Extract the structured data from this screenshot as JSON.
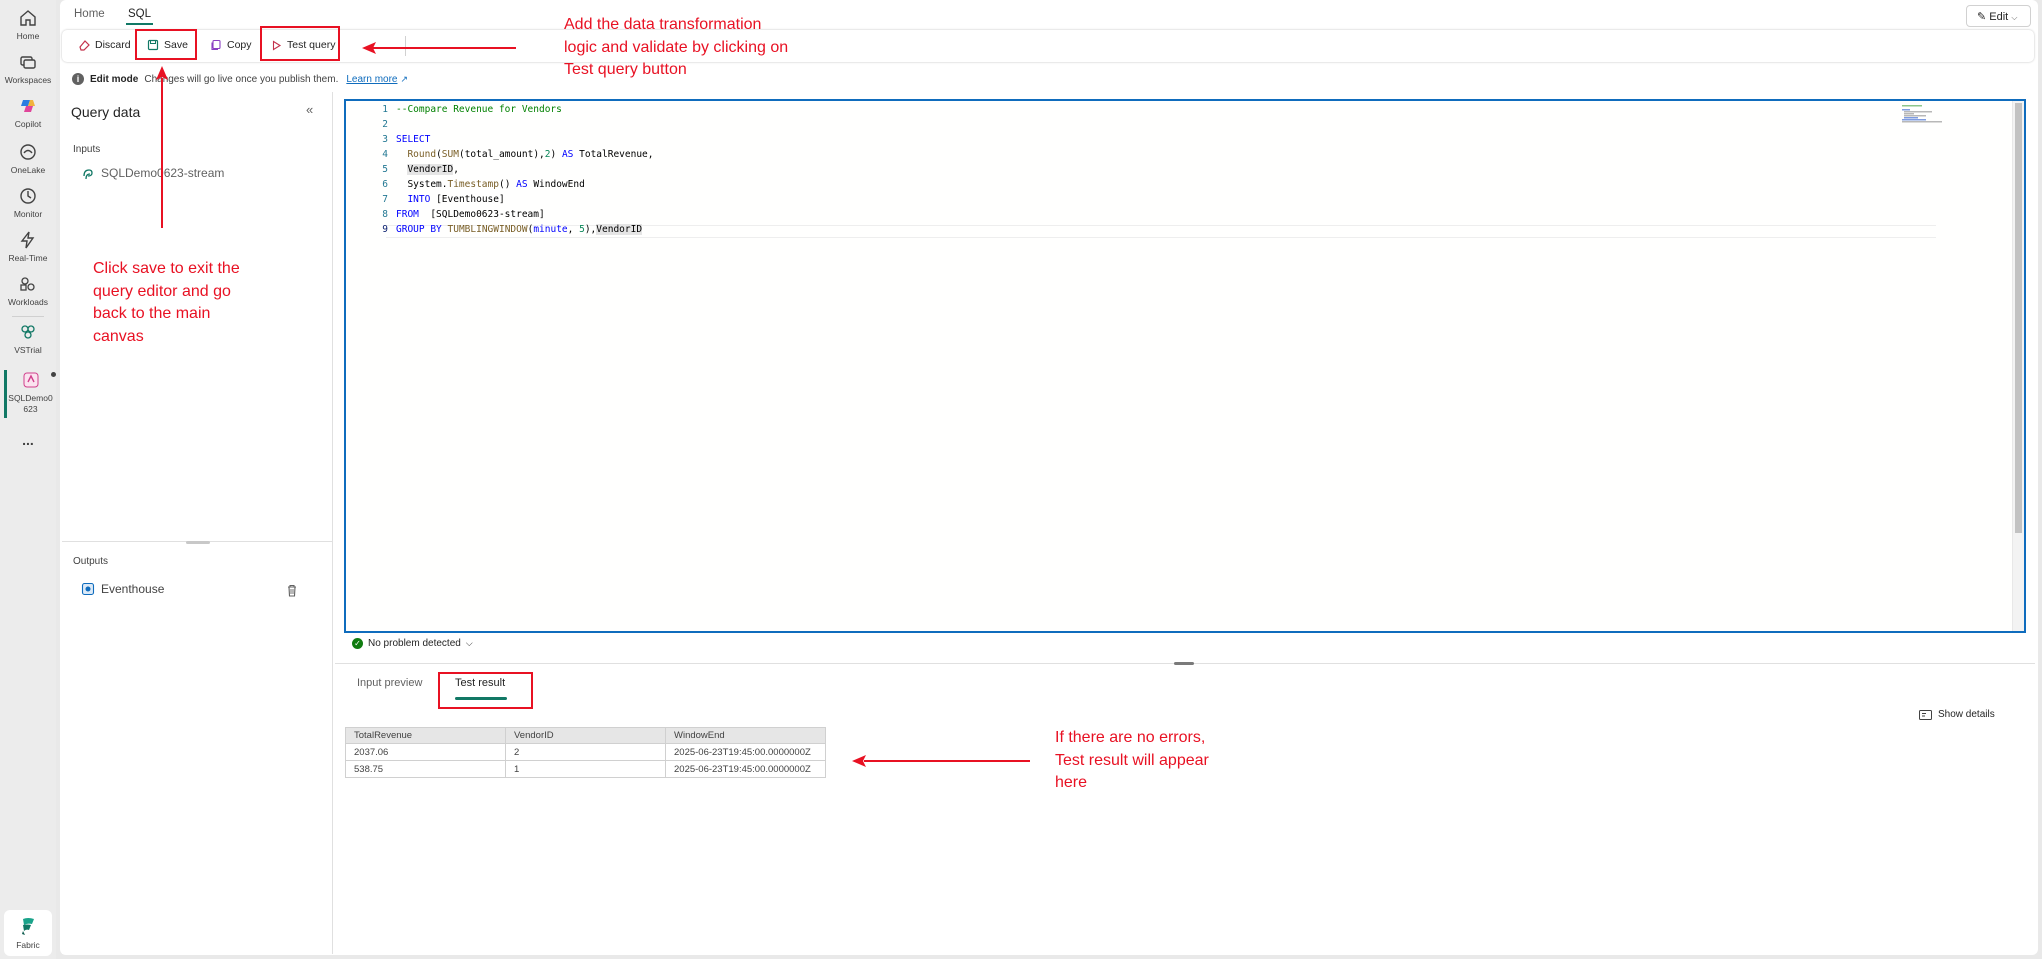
{
  "rail": {
    "items": [
      {
        "label": "Home"
      },
      {
        "label": "Workspaces"
      },
      {
        "label": "Copilot"
      },
      {
        "label": "OneLake"
      },
      {
        "label": "Monitor"
      },
      {
        "label": "Real-Time"
      },
      {
        "label": "Workloads"
      },
      {
        "label": "VSTrial"
      }
    ],
    "active_item": {
      "label_line1": "SQLDemo0",
      "label_line2": "623"
    },
    "more": "...",
    "footer": {
      "label": "Fabric"
    }
  },
  "tabs": [
    {
      "label": "Home"
    },
    {
      "label": "SQL"
    }
  ],
  "edit_button": {
    "label": "Edit"
  },
  "toolbar": {
    "discard_label": "Discard",
    "save_label": "Save",
    "copy_label": "Copy",
    "test_query_label": "Test query"
  },
  "infobar": {
    "mode": "Edit mode",
    "message": "Changes will go live once you publish them.",
    "link": "Learn more"
  },
  "query_panel": {
    "title": "Query data",
    "inputs_label": "Inputs",
    "input_item": "SQLDemo0623-stream",
    "outputs_label": "Outputs",
    "output_item": "Eventhouse"
  },
  "editor": {
    "line_numbers": [
      "1",
      "2",
      "3",
      "4",
      "5",
      "6",
      "7",
      "8",
      "9"
    ]
  },
  "status": {
    "text": "No problem detected"
  },
  "results": {
    "tabs": [
      {
        "label": "Input preview"
      },
      {
        "label": "Test result"
      }
    ],
    "show_details": "Show details",
    "columns": [
      "TotalRevenue",
      "VendorID",
      "WindowEnd"
    ],
    "rows": [
      [
        "2037.06",
        "2",
        "2025-06-23T19:45:00.0000000Z"
      ],
      [
        "538.75",
        "1",
        "2025-06-23T19:45:00.0000000Z"
      ]
    ]
  },
  "annotations": {
    "top": [
      "Add the data transformation",
      "logic and validate by clicking on",
      "Test query button"
    ],
    "left": [
      "Click save to exit the",
      "query editor and go",
      "back to the main",
      "canvas"
    ],
    "right": [
      "If there are no errors,",
      "Test result will appear",
      "here"
    ]
  },
  "colors": {
    "accent": "#117865",
    "annotation": "#e81123",
    "editor_border": "#0f6cbd"
  }
}
